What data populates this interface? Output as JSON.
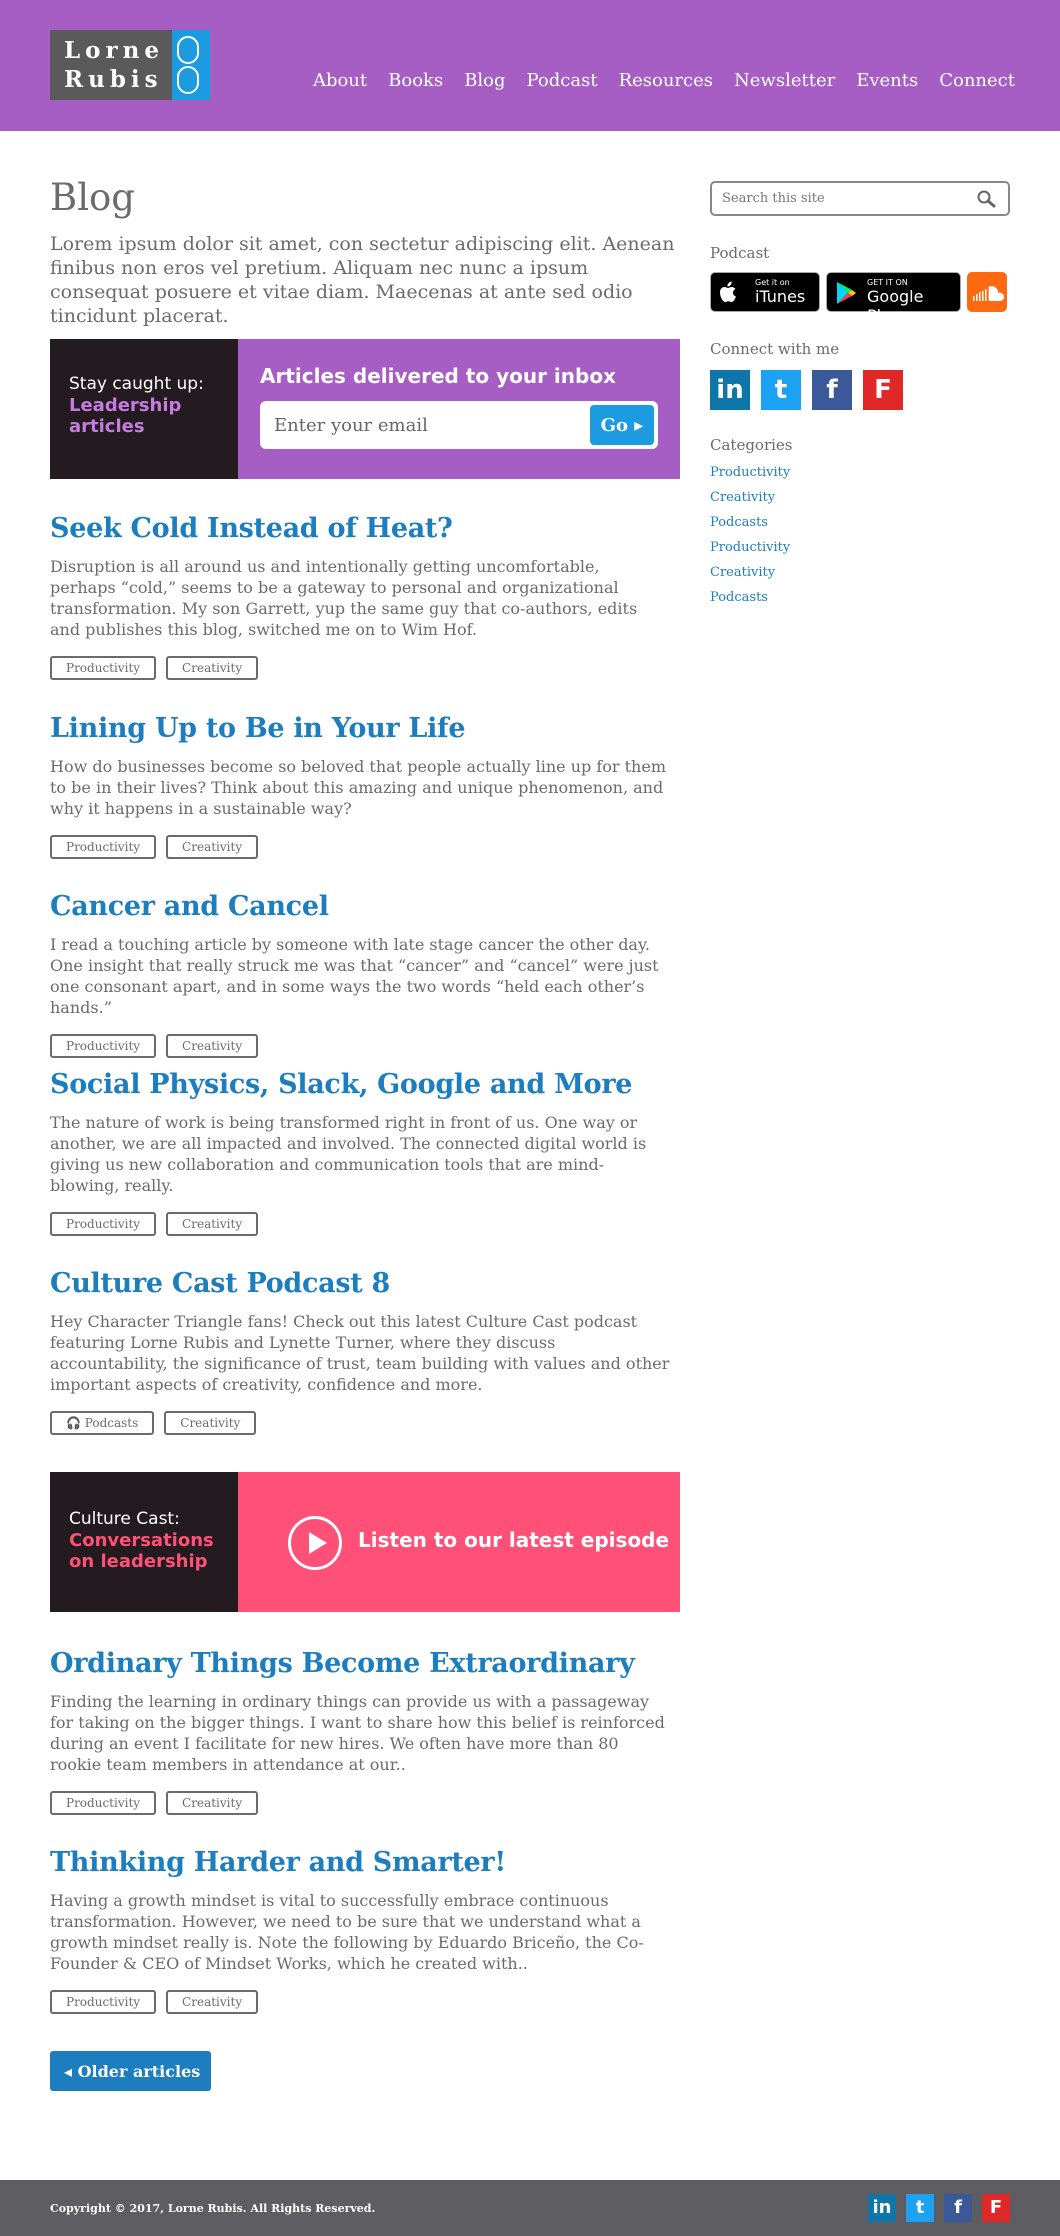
{
  "logo": {
    "line1": "Lorne",
    "line2": "Rubis"
  },
  "nav": [
    "About",
    "Books",
    "Blog",
    "Podcast",
    "Resources",
    "Newsletter",
    "Events",
    "Connect"
  ],
  "page": {
    "title": "Blog",
    "intro": "Lorem ipsum dolor sit amet, con sectetur adipiscing elit. Aenean finibus non eros vel pretium. Aliquam nec nunc a ipsum consequat posuere et vitae diam. Maecenas at ante sed odio tincidunt placerat."
  },
  "subscribe": {
    "line1": "Stay caught up:",
    "line2a": "Leadership",
    "line2b": "articles",
    "heading": "Articles delivered to your inbox",
    "placeholder": "Enter your email",
    "button": "Go ▸"
  },
  "posts": [
    {
      "title": "Seek Cold Instead of Heat?",
      "excerpt": "Disruption is all around us and intentionally getting uncomfortable, perhaps “cold,” seems to be a gateway to personal and organizational transformation. My son Garrett, yup the same guy that co-authors, edits and publishes this blog, switched me on to Wim Hof.",
      "tags": [
        "Productivity",
        "Creativity"
      ]
    },
    {
      "title": "Lining Up to Be in Your Life",
      "excerpt": "How do businesses become so beloved that people actually line up for them to be in their lives? Think about this amazing and unique phenomenon, and why it happens in a sustainable way?",
      "tags": [
        "Productivity",
        "Creativity"
      ]
    },
    {
      "title": "Cancer and Cancel",
      "excerpt": "I read a touching article by someone with late stage cancer the other day. One insight that really struck me was that “cancer” and “cancel” were just one consonant apart, and in some ways the two words “held each other’s hands.”",
      "tags": [
        "Productivity",
        "Creativity"
      ]
    },
    {
      "title": "Social Physics, Slack, Google and More",
      "excerpt": "The nature of work is being transformed right in front of us. One way or another, we are all impacted and involved. The connected digital world is giving us new collaboration and communication tools that are mind-blowing, really.",
      "tags": [
        "Productivity",
        "Creativity"
      ]
    },
    {
      "title": "Culture Cast Podcast 8",
      "excerpt": "Hey Character Triangle fans! Check out this latest Culture Cast podcast featuring Lorne Rubis and Lynette Turner, where they discuss accountability, the significance of trust, team building with values and other important aspects of creativity, confidence and more.",
      "tags": [
        "🎧 Podcasts",
        "Creativity"
      ]
    },
    {
      "title": "Ordinary Things Become Extraordinary",
      "excerpt": "Finding the learning in ordinary things can provide us with a passageway for taking on the bigger things. I want to share how this belief is reinforced during an event I facilitate for new hires. We often have more than 80 rookie team members in attendance at our..",
      "tags": [
        "Productivity",
        "Creativity"
      ]
    },
    {
      "title": "Thinking Harder and Smarter!",
      "excerpt": "Having a growth mindset is vital to successfully embrace continuous transformation. However, we need to be sure that we understand what a growth mindset really is. Note the following by Eduardo Briceño, the Co-Founder & CEO of Mindset Works, which he created with..",
      "tags": [
        "Productivity",
        "Creativity"
      ]
    }
  ],
  "podcast_banner": {
    "line1": "Culture Cast:",
    "line2a": "Conversations",
    "line2b": "on leadership",
    "cta": "Listen to our latest episode"
  },
  "older_button": "◂  Older articles",
  "sidebar": {
    "search_placeholder": "Search this site",
    "podcast_label": "Podcast",
    "itunes_small": "Get it on",
    "itunes_big": "iTunes",
    "gplay_small": "GET IT ON",
    "gplay_big": "Google Play",
    "connect_label": "Connect with me",
    "categories_label": "Categories",
    "categories": [
      "Productivity",
      "Creativity",
      "Podcasts",
      "Productivity",
      "Creativity",
      "Podcasts"
    ]
  },
  "social_glyphs": {
    "linkedin": "in",
    "twitter": "t",
    "facebook": "f",
    "flipboard": "F"
  },
  "colors": {
    "header": "#a75ec4",
    "link": "#1c7ebf",
    "accent_blue": "#1c9be0",
    "podcast_pink": "#ff5077",
    "footer": "#5e5e62"
  },
  "footer": {
    "copyright": "Copyright © 2017, Lorne Rubis. All Rights Reserved."
  }
}
